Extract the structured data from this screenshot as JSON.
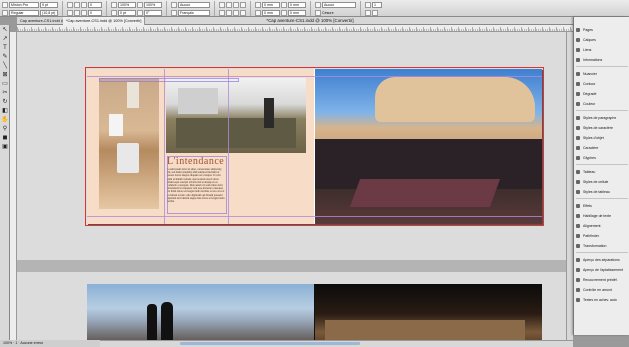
{
  "control_bar": {
    "font_family": "Minion Pro",
    "font_style": "Regular",
    "font_size": "9 pt",
    "leading": "(10,8 pt)",
    "tracking": "0",
    "scale_pct": "100%",
    "baseline": "0 pt",
    "angle": "0°",
    "language": "Français",
    "style_none": "Aucun",
    "indents": [
      "0 mm",
      "0 mm",
      "0 mm",
      "0 mm"
    ],
    "columns": "1",
    "hyphenate_label": "Césure"
  },
  "tabs": [
    {
      "label": "Cap aventure-CS1.indd @ 111%",
      "active": false
    },
    {
      "label": "*Cap aventure-CS1.indd @ 100% [Convertir]",
      "active": true
    }
  ],
  "window_title": "*Cap aventure-CS1.indd @ 100% [Convertir]",
  "ruler_ticks": [
    "-200",
    "-150",
    "-100",
    "-50",
    "0",
    "50",
    "100",
    "150",
    "200",
    "250",
    "300",
    "350",
    "400"
  ],
  "document": {
    "headline": "L'intendance",
    "body_text": "Lorem ipsum dolor sit amet, consectetuer adipiscing elit, sed diam nonummy nibh euismod tincidunt ut laoreet dolore magna aliquam erat volutpat. Ut wisi enim ad minim veniam, quis nostrud exerci tation ullamcorper suscipit lobortis nisl ut aliquip ex ea commodo consequat. Duis autem vel eum iriure dolor in hendrerit in vulputate velit esse molestie consequat, vel illum dolore eu feugiat nulla facilisis at vero eros et accumsan et iusto odio dignissim qui blandit praesent luptatum zzril delenit augue duis dolore te feugait nulla facilisi."
  },
  "panel_menu": {
    "items": [
      {
        "label": "Pages",
        "icon": "pages-icon"
      },
      {
        "label": "Calques",
        "icon": "layers-icon"
      },
      {
        "label": "Liens",
        "icon": "links-icon"
      },
      {
        "label": "Informations",
        "icon": "info-icon"
      },
      {
        "label": "Nuancier",
        "icon": "swatches-icon"
      },
      {
        "label": "Contour",
        "icon": "stroke-icon"
      },
      {
        "label": "Dégradé",
        "icon": "gradient-icon"
      },
      {
        "label": "Couleur",
        "icon": "color-icon"
      },
      {
        "label": "Styles de paragraphe",
        "icon": "paragraph-styles-icon"
      },
      {
        "label": "Styles de caractère",
        "icon": "character-styles-icon"
      },
      {
        "label": "Styles d'objet",
        "icon": "object-styles-icon"
      },
      {
        "label": "Caractère",
        "icon": "character-icon"
      },
      {
        "label": "Glyphes",
        "icon": "glyphs-icon"
      },
      {
        "label": "Tableau",
        "icon": "table-icon"
      },
      {
        "label": "Styles de cellule",
        "icon": "cell-styles-icon"
      },
      {
        "label": "Styles de tableau",
        "icon": "table-styles-icon"
      },
      {
        "label": "Effets",
        "icon": "effects-icon"
      },
      {
        "label": "Habillage de texte",
        "icon": "text-wrap-icon"
      },
      {
        "label": "Alignement",
        "icon": "align-icon"
      },
      {
        "label": "Pathfinder",
        "icon": "pathfinder-icon"
      },
      {
        "label": "Transformation",
        "icon": "transform-icon"
      },
      {
        "label": "Aperçu des séparations",
        "icon": "separations-icon"
      },
      {
        "label": "Aperçu de l'aplatissement",
        "icon": "flattener-icon"
      },
      {
        "label": "Recouvrement prédéf.",
        "icon": "trap-icon"
      },
      {
        "label": "Contrôle en amont",
        "icon": "preflight-icon"
      },
      {
        "label": "Textes en achev. auto",
        "icon": "autocorrect-icon"
      }
    ]
  },
  "status": {
    "zoom": "100%",
    "page": "1",
    "state": "Aucune erreur"
  },
  "colors": {
    "accent": "#a0522d",
    "page_tint": "#f7dcc8",
    "guides": "#b28ad9",
    "bleed": "#dd3333"
  }
}
